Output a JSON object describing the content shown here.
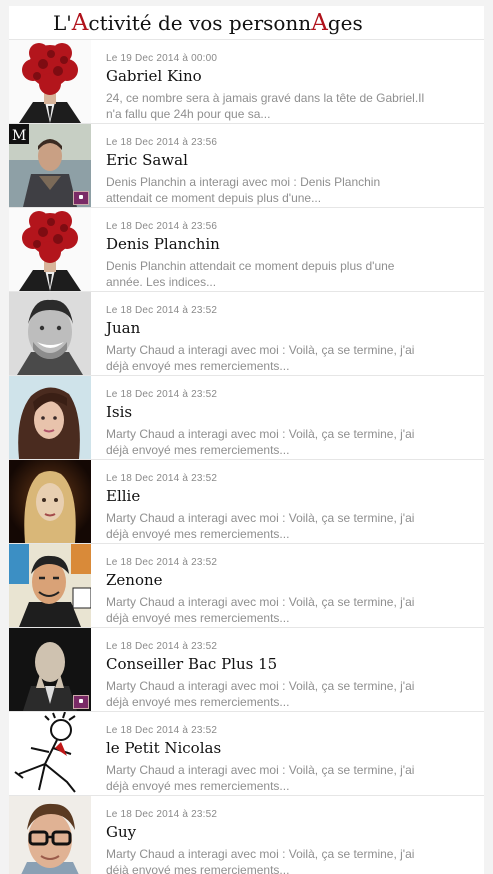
{
  "header": {
    "title_parts": [
      {
        "text": "L'",
        "cap": false
      },
      {
        "text": "A",
        "cap": true
      },
      {
        "text": "ctivité de vos personn",
        "cap": false
      },
      {
        "text": "A",
        "cap": true
      },
      {
        "text": "ges",
        "cap": false
      }
    ]
  },
  "activities": [
    {
      "date": "Le 19 Dec 2014 à 00:00",
      "name": "Gabriel Kino",
      "snippet": "24, ce nombre sera à jamais gravé dans la tête de Gabriel.Il n'a fallu que 24h pour que sa...",
      "avatar": "rose-head-avatar",
      "badge": false
    },
    {
      "date": "Le 18 Dec 2014 à 23:56",
      "name": "Eric Sawal",
      "snippet": "Denis Planchin a interagi avec moi : Denis Planchin attendait ce moment depuis plus d'une...",
      "avatar": "man-in-jacket-avatar",
      "badge": true
    },
    {
      "date": "Le 18 Dec 2014 à 23:56",
      "name": "Denis Planchin",
      "snippet": "Denis Planchin attendait ce moment depuis plus d'une année. Les indices...",
      "avatar": "rose-head-avatar",
      "badge": false
    },
    {
      "date": "Le 18 Dec 2014 à 23:52",
      "name": "Juan",
      "snippet": "Marty Chaud a interagi avec moi : Voilà, ça se termine, j'ai déjà envoyé mes remerciements...",
      "avatar": "smiling-man-avatar",
      "badge": false
    },
    {
      "date": "Le 18 Dec 2014 à 23:52",
      "name": "Isis",
      "snippet": "Marty Chaud a interagi avec moi : Voilà, ça se termine, j'ai déjà envoyé mes remerciements...",
      "avatar": "woman-portrait-avatar",
      "badge": false
    },
    {
      "date": "Le 18 Dec 2014 à 23:52",
      "name": "Ellie",
      "snippet": "Marty Chaud a interagi avec moi : Voilà, ça se termine, j'ai déjà envoyé mes remerciements...",
      "avatar": "blonde-painting-avatar",
      "badge": false
    },
    {
      "date": "Le 18 Dec 2014 à 23:52",
      "name": "Zenone",
      "snippet": "Marty Chaud a interagi avec moi : Voilà, ça se termine, j'ai déjà envoyé mes remerciements...",
      "avatar": "comic-man-avatar",
      "badge": false
    },
    {
      "date": "Le 18 Dec 2014 à 23:52",
      "name": "Conseiller Bac Plus 15",
      "snippet": "Marty Chaud a interagi avec moi : Voilà, ça se termine, j'ai déjà envoyé mes remerciements...",
      "avatar": "egg-head-avatar",
      "badge": true
    },
    {
      "date": "Le 18 Dec 2014 à 23:52",
      "name": "le Petit Nicolas",
      "snippet": "Marty Chaud a interagi avec moi : Voilà, ça se termine, j'ai déjà envoyé mes remerciements...",
      "avatar": "cartoon-boy-avatar",
      "badge": false
    },
    {
      "date": "Le 18 Dec 2014 à 23:52",
      "name": "Guy",
      "snippet": "Marty Chaud a interagi avec moi : Voilà, ça se termine, j'ai déjà envoyé mes remerciements...",
      "avatar": "glasses-man-avatar",
      "badge": false
    }
  ]
}
